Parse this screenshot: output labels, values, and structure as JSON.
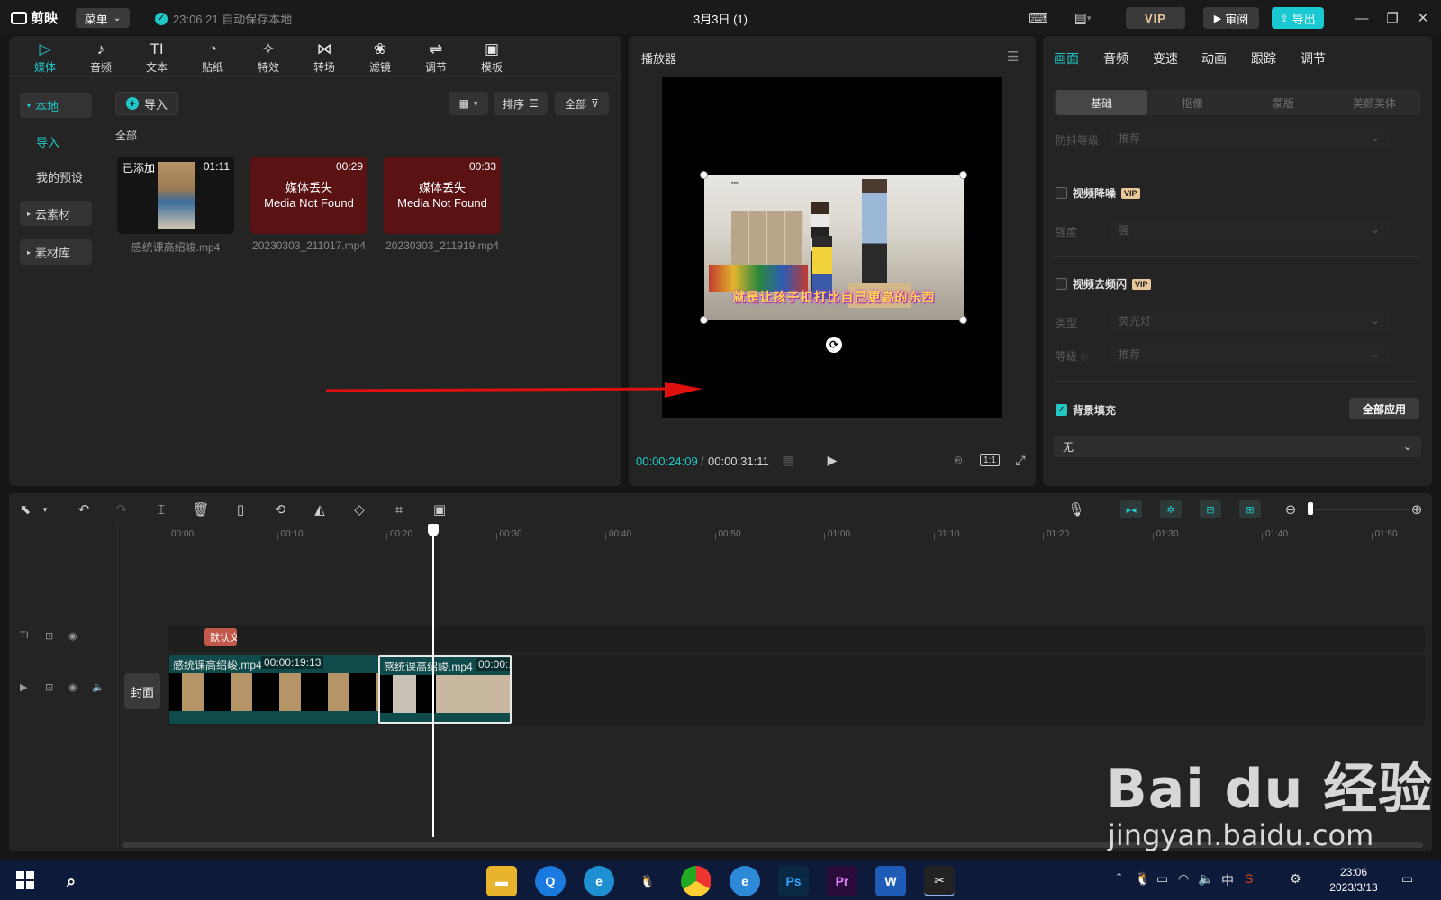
{
  "titlebar": {
    "app_name": "剪映",
    "menu_label": "菜单",
    "save_status": "23:06:21 自动保存本地",
    "project_title": "3月3日 (1)",
    "vip_label": "VIP",
    "review_label": "审阅",
    "export_label": "导出"
  },
  "tool_tabs": [
    {
      "label": "媒体",
      "icon": "▷"
    },
    {
      "label": "音频",
      "icon": "♪"
    },
    {
      "label": "文本",
      "icon": "TI"
    },
    {
      "label": "贴纸",
      "icon": "◔"
    },
    {
      "label": "特效",
      "icon": "✧"
    },
    {
      "label": "转场",
      "icon": "⋈"
    },
    {
      "label": "滤镜",
      "icon": "❀"
    },
    {
      "label": "调节",
      "icon": "⇌"
    },
    {
      "label": "模板",
      "icon": "▣"
    }
  ],
  "side_nav": {
    "local": "本地",
    "import": "导入",
    "my_presets": "我的预设",
    "cloud": "云素材",
    "library": "素材库"
  },
  "media": {
    "import_label": "导入",
    "sort_label": "排序",
    "filter_label": "全部",
    "all_label": "全部",
    "cards": [
      {
        "badge": "已添加",
        "duration": "01:11",
        "name": "感统课高绍峻.mp4"
      },
      {
        "duration": "00:29",
        "line1": "媒体丢失",
        "line2": "Media Not Found",
        "name": "20230303_211017.mp4"
      },
      {
        "duration": "00:33",
        "line1": "媒体丢失",
        "line2": "Media Not Found",
        "name": "20230303_211919.mp4"
      }
    ]
  },
  "player": {
    "title": "播放器",
    "caption": "就是让孩子扣打比自己更高的东西",
    "current_time": "00:00:24:09",
    "separator": "/",
    "total_time": "00:00:31:11",
    "ratio_label": "1:1"
  },
  "props": {
    "tabs": [
      "画面",
      "音频",
      "变速",
      "动画",
      "跟踪",
      "调节"
    ],
    "sub_tabs": [
      "基础",
      "抠像",
      "蒙版",
      "美颜美体"
    ],
    "stabilize_label": "防抖等级",
    "stabilize_value": "推荐",
    "denoise_label": "视频降噪",
    "strength_label": "强度",
    "strength_value": "强",
    "deflicker_label": "视频去频闪",
    "type_label": "类型",
    "type_value": "荧光灯",
    "level_label": "等级",
    "level_value": "推荐",
    "bg_fill_label": "背景填充",
    "apply_all_label": "全部应用",
    "bg_value": "无",
    "vip_tag": "VIP"
  },
  "timeline": {
    "ruler": [
      "00:00",
      "00:10",
      "00:20",
      "00:30",
      "00:40",
      "00:50",
      "01:00",
      "01:10",
      "01:20",
      "01:30",
      "01:40",
      "01:50"
    ],
    "cover_label": "封面",
    "text_clip_label": "默认文本",
    "clips": [
      {
        "name": "感统课高绍峻.mp4",
        "duration": "00:00:19:13"
      },
      {
        "name": "感统课高绍峻.mp4",
        "duration": "00:00:1"
      }
    ]
  },
  "taskbar": {
    "time": "23:06",
    "date": "2023/3/13",
    "ime": "中"
  },
  "watermark": {
    "brand": "Bai du 经验",
    "url": "jingyan.baidu.com"
  }
}
